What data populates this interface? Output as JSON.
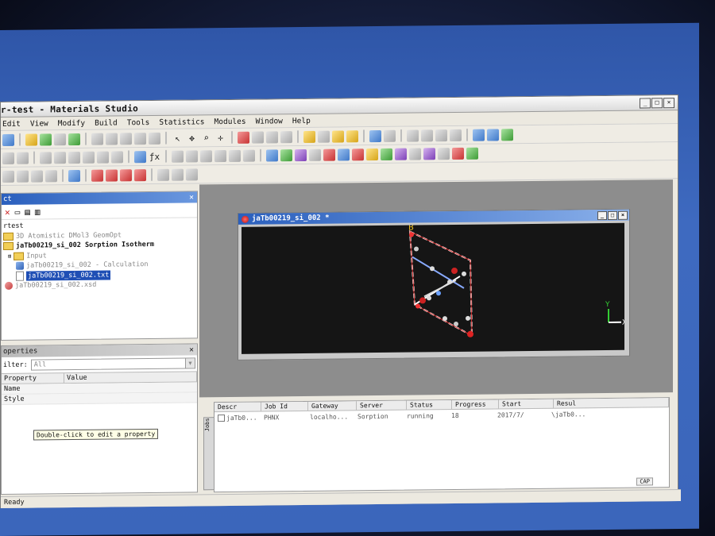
{
  "window": {
    "title": "r-test - Materials Studio"
  },
  "menu": [
    "Edit",
    "View",
    "Modify",
    "Build",
    "Tools",
    "Statistics",
    "Modules",
    "Window",
    "Help"
  ],
  "project": {
    "header": "ct",
    "items": [
      {
        "label": "rtest",
        "kind": "root"
      },
      {
        "label": "3D Atomistic DMol3 GeomOpt",
        "kind": "folder"
      },
      {
        "label": "jaTb00219_si_002 Sorption Isotherm",
        "kind": "folder"
      },
      {
        "label": "Input",
        "kind": "folder"
      },
      {
        "label": "jaTb00219_si_002 - Calculation",
        "kind": "calc"
      },
      {
        "label": "jaTb00219_si_002.txt",
        "kind": "file"
      },
      {
        "label": "jaTb00219_si_002.xsd",
        "kind": "xsd"
      }
    ]
  },
  "properties": {
    "header": "operties",
    "filter_label": "ilter:",
    "filter_value": "All",
    "columns": [
      "Property",
      "Value"
    ],
    "rows": [
      "Name",
      "Style"
    ],
    "tooltip": "Double-click to edit a property"
  },
  "document": {
    "title": "jaTb00219_si_002 *",
    "axis_x": "X",
    "axis_y": "Y",
    "atom_label": "B"
  },
  "jobs": {
    "tab": "Jobs",
    "columns": [
      "Descr",
      "Job Id",
      "Gateway",
      "Server",
      "Status",
      "Progress",
      "Start",
      "Resul"
    ],
    "rows": [
      [
        "jaTb0...",
        "PHNX",
        "localho...",
        "Sorption",
        "running",
        "18",
        "2017/7/",
        "\\jaTb0..."
      ]
    ],
    "caps": "CAP"
  },
  "status": {
    "text": "Ready"
  }
}
